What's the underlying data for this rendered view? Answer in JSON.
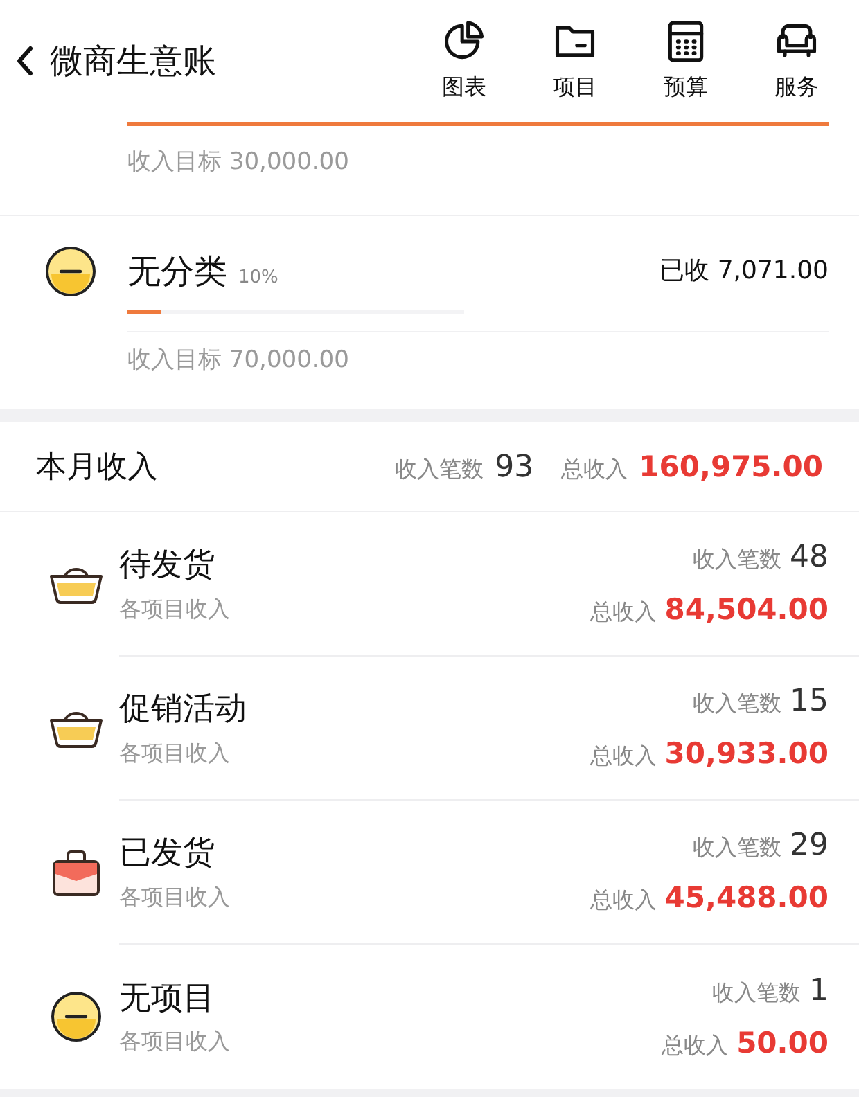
{
  "header": {
    "title": "微商生意账",
    "actions": [
      {
        "label": "图表"
      },
      {
        "label": "项目"
      },
      {
        "label": "预算"
      },
      {
        "label": "服务"
      }
    ]
  },
  "categories": [
    {
      "kind": "partial",
      "level": 1,
      "goal": "收入目标 30,000.00"
    },
    {
      "kind": "coin",
      "name": "无分类",
      "percent": "10%",
      "received": "已收 7,071.00",
      "level": 0.1,
      "goal": "收入目标 70,000.00"
    }
  ],
  "month": {
    "title": "本月收入",
    "count_label": "收入笔数",
    "count": "93",
    "total_label": "总收入",
    "total": "160,975.00"
  },
  "projects": [
    {
      "kind": "ingot",
      "name": "待发货",
      "subtitle": "各项目收入",
      "count_label": "收入笔数",
      "count": "48",
      "total_label": "总收入",
      "total": "84,504.00"
    },
    {
      "kind": "ingot",
      "name": "促销活动",
      "subtitle": "各项目收入",
      "count_label": "收入笔数",
      "count": "15",
      "total_label": "总收入",
      "total": "30,933.00"
    },
    {
      "kind": "bag",
      "name": "已发货",
      "subtitle": "各项目收入",
      "count_label": "收入笔数",
      "count": "29",
      "total_label": "总收入",
      "total": "45,488.00"
    },
    {
      "kind": "coin",
      "name": "无项目",
      "subtitle": "各项目收入",
      "count_label": "收入笔数",
      "count": "1",
      "total_label": "总收入",
      "total": "50.00"
    }
  ]
}
